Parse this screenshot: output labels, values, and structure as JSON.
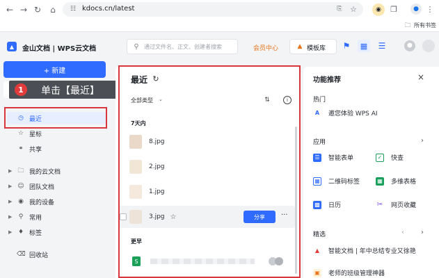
{
  "browser": {
    "url": "kdocs.cn/latest",
    "bookmarks_label": "所有书签"
  },
  "header": {
    "logo_text": "金山文档 | WPS云文档",
    "search_placeholder": "通过文件名、正文、创建者搜索",
    "member_center": "会员中心",
    "template_lib": "模板库"
  },
  "sidebar": {
    "new_button": "+ 新建",
    "callout": {
      "number": "1",
      "text": "单击【最近】"
    },
    "items": [
      {
        "label": "最近",
        "icon": "clock-icon"
      },
      {
        "label": "星标",
        "icon": "star-icon"
      },
      {
        "label": "共享",
        "icon": "share-icon"
      },
      {
        "label": "我的云文档",
        "icon": "folder-icon"
      },
      {
        "label": "团队文档",
        "icon": "team-icon"
      },
      {
        "label": "我的设备",
        "icon": "device-icon"
      },
      {
        "label": "常用",
        "icon": "pin-icon"
      },
      {
        "label": "标签",
        "icon": "tag-icon"
      },
      {
        "label": "回收站",
        "icon": "trash-icon"
      }
    ]
  },
  "main": {
    "title": "最近",
    "filter": "全部类型",
    "group_recent": "7天内",
    "group_earlier": "更早",
    "files": [
      {
        "name": "8.jpg"
      },
      {
        "name": "2.jpg"
      },
      {
        "name": "1.jpg"
      },
      {
        "name": "3.jpg"
      }
    ],
    "share_button": "分享",
    "more": "···"
  },
  "right_panel": {
    "title": "功能推荐",
    "hot_title": "热门",
    "hot_item": "邀您体验 WPS AI",
    "apps_title": "应用",
    "apps": [
      {
        "label": "智能表单",
        "color": "#2f6bff"
      },
      {
        "label": "快查",
        "color": "#19a05c"
      },
      {
        "label": "二维码标签",
        "color": "#2f6bff"
      },
      {
        "label": "多维表格",
        "color": "#19a05c"
      },
      {
        "label": "日历",
        "color": "#2f6bff"
      },
      {
        "label": "网页收藏",
        "color": "#7a4be8"
      }
    ],
    "picks_title": "精选",
    "picks": [
      {
        "label": "智能文档 | 年中总结专业又徐艳"
      },
      {
        "label": "老师的班级管理神器"
      }
    ]
  },
  "colors": {
    "accent": "#2f6bff",
    "highlight": "#d9363e"
  }
}
